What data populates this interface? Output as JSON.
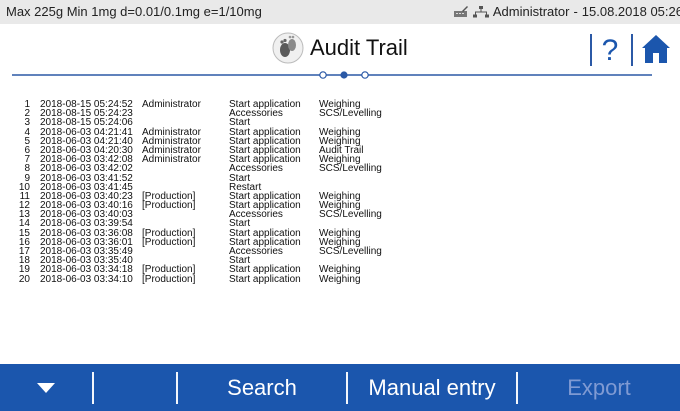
{
  "status": {
    "left": "Max 225g  Min 1mg  d=0.01/0.1mg  e=1/10mg",
    "user": "Administrator",
    "sep": "-",
    "date": "15.08.2018 05:26"
  },
  "header": {
    "title": "Audit Trail",
    "help": "?"
  },
  "entries": [
    {
      "n": "1",
      "dt": "2018-08-15 05:24:52",
      "user": "Administrator",
      "action": "Start application",
      "detail": "Weighing"
    },
    {
      "n": "2",
      "dt": "2018-08-15 05:24:23",
      "user": "",
      "action": "Accessories",
      "detail": "SCS/Levelling"
    },
    {
      "n": "3",
      "dt": "2018-08-15 05:24:06",
      "user": "",
      "action": "Start",
      "detail": ""
    },
    {
      "n": "4",
      "dt": "2018-06-03 04:21:41",
      "user": "Administrator",
      "action": "Start application",
      "detail": "Weighing"
    },
    {
      "n": "5",
      "dt": "2018-06-03 04:21:40",
      "user": "Administrator",
      "action": "Start application",
      "detail": "Weighing"
    },
    {
      "n": "6",
      "dt": "2018-06-03 04:20:30",
      "user": "Administrator",
      "action": "Start application",
      "detail": "Audit Trail"
    },
    {
      "n": "7",
      "dt": "2018-06-03 03:42:08",
      "user": "Administrator",
      "action": "Start application",
      "detail": "Weighing"
    },
    {
      "n": "8",
      "dt": "2018-06-03 03:42:02",
      "user": "",
      "action": "Accessories",
      "detail": "SCS/Levelling"
    },
    {
      "n": "9",
      "dt": "2018-06-03 03:41:52",
      "user": "",
      "action": "Start",
      "detail": ""
    },
    {
      "n": "10",
      "dt": "2018-06-03 03:41:45",
      "user": "",
      "action": "Restart",
      "detail": ""
    },
    {
      "n": "11",
      "dt": "2018-06-03 03:40:23",
      "user": "[Production]",
      "action": "Start application",
      "detail": "Weighing"
    },
    {
      "n": "12",
      "dt": "2018-06-03 03:40:16",
      "user": "[Production]",
      "action": "Start application",
      "detail": "Weighing"
    },
    {
      "n": "13",
      "dt": "2018-06-03 03:40:03",
      "user": "",
      "action": "Accessories",
      "detail": "SCS/Levelling"
    },
    {
      "n": "14",
      "dt": "2018-06-03 03:39:54",
      "user": "",
      "action": "Start",
      "detail": ""
    },
    {
      "n": "15",
      "dt": "2018-06-03 03:36:08",
      "user": "[Production]",
      "action": "Start application",
      "detail": "Weighing"
    },
    {
      "n": "16",
      "dt": "2018-06-03 03:36:01",
      "user": "[Production]",
      "action": "Start application",
      "detail": "Weighing"
    },
    {
      "n": "17",
      "dt": "2018-06-03 03:35:49",
      "user": "",
      "action": "Accessories",
      "detail": "SCS/Levelling"
    },
    {
      "n": "18",
      "dt": "2018-06-03 03:35:40",
      "user": "",
      "action": "Start",
      "detail": ""
    },
    {
      "n": "19",
      "dt": "2018-06-03 03:34:18",
      "user": "[Production]",
      "action": "Start application",
      "detail": "Weighing"
    },
    {
      "n": "20",
      "dt": "2018-06-03 03:34:10",
      "user": "[Production]",
      "action": "Start application",
      "detail": "Weighing"
    }
  ],
  "footer": {
    "search": "Search",
    "manual": "Manual entry",
    "export": "Export"
  },
  "colors": {
    "accent": "#1b56ad",
    "disabled": "#7f9ad3"
  }
}
